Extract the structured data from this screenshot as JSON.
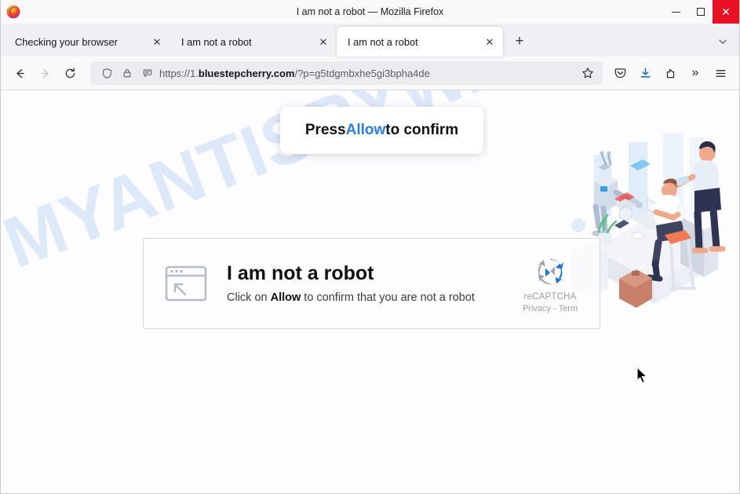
{
  "window": {
    "title": "I am not a robot — Mozilla Firefox",
    "logo_icon": "firefox-logo",
    "minimize_icon": "minimize-icon",
    "maximize_icon": "maximize-icon",
    "close_icon": "close-icon",
    "close_label": "✕",
    "accent_close_color": "#e81123"
  },
  "tabs": {
    "items": [
      {
        "label": "Checking your browser",
        "close_label": "✕",
        "active": false
      },
      {
        "label": "I am not a robot",
        "close_label": "✕",
        "active": false
      },
      {
        "label": "I am not a robot",
        "close_label": "✕",
        "active": true
      }
    ],
    "new_tab_label": "+",
    "list_all_tabs_icon": "chevron-down-icon"
  },
  "toolbar": {
    "back_icon": "arrow-left-icon",
    "forward_icon": "arrow-right-icon",
    "reload_icon": "reload-icon",
    "shield_icon": "shield-icon",
    "lock_icon": "lock-icon",
    "permissions_icon": "speech-bubble-icon",
    "bookmark_icon": "star-icon",
    "pocket_icon": "pocket-icon",
    "downloads_icon": "download-icon",
    "account_icon": "account-share-icon",
    "overflow_label": "»",
    "menu_icon": "hamburger-menu-icon"
  },
  "urlbar": {
    "scheme": "https://1.",
    "domain": "bluestepcherry.com",
    "path": "/?p=g5tdgmbxhe5gi3bpha4de",
    "full_url": "https://1.bluestepcherry.com/?p=g5tdgmbxhe5gi3bpha4de"
  },
  "page": {
    "watermark": "MYANTISPYWARE.COM",
    "watermark_color": "#96b9eb",
    "press_box": {
      "prefix": "Press ",
      "highlight": "Allow",
      "suffix": " to confirm",
      "highlight_color": "#2b7de9"
    },
    "captcha": {
      "icon": "browser-window-cursor-icon",
      "title": "I am not a robot",
      "sub_prefix": "Click on ",
      "sub_bold": "Allow",
      "sub_suffix": " to confirm that you are not a robot",
      "recaptcha_logo_icon": "recaptcha-logo-icon",
      "recaptcha_name": "reCAPTCHA",
      "recaptcha_links": "Privacy - Term"
    },
    "illustration": "office-robot-desk-illustration",
    "cursor": "mouse-pointer-icon"
  }
}
